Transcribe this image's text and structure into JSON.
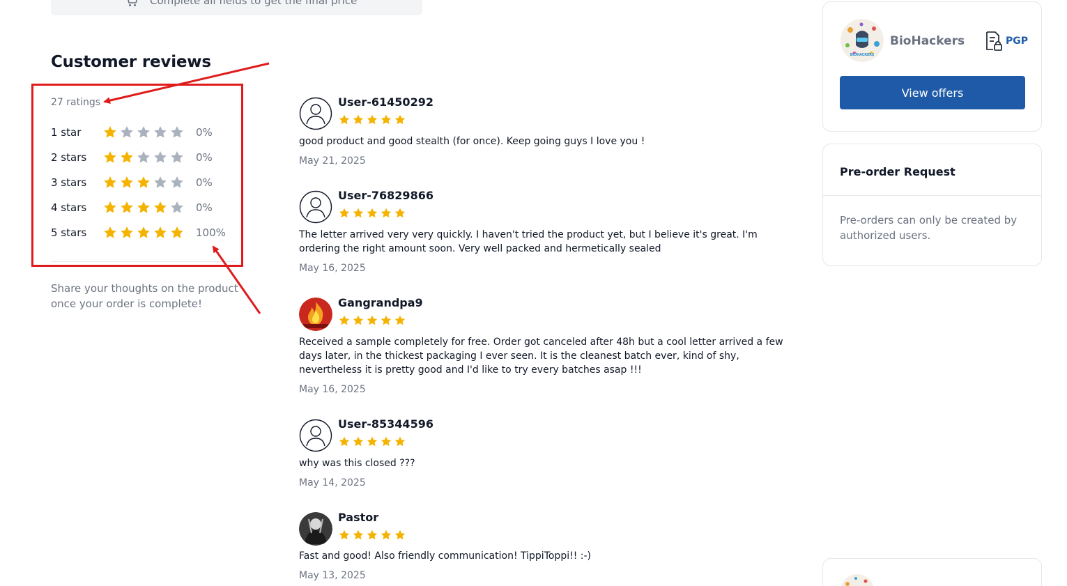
{
  "price_bar": {
    "text": "Complete all fields to get the final price"
  },
  "reviews": {
    "title": "Customer reviews",
    "ratings_count": "27 ratings",
    "breakdown": [
      {
        "label": "1 star",
        "filled": 1,
        "percent": "0%"
      },
      {
        "label": "2 stars",
        "filled": 2,
        "percent": "0%"
      },
      {
        "label": "3 stars",
        "filled": 3,
        "percent": "0%"
      },
      {
        "label": "4 stars",
        "filled": 4,
        "percent": "0%"
      },
      {
        "label": "5 stars",
        "filled": 5,
        "percent": "100%"
      }
    ],
    "share_note": "Share your thoughts on the product once your order is complete!",
    "items": [
      {
        "user": "User-61450292",
        "rating": 5,
        "text": "good product and good stealth (for once). Keep going guys I love you !",
        "date": "May 21, 2025",
        "avatar": "default-avatar"
      },
      {
        "user": "User-76829866",
        "rating": 5,
        "text": "The letter arrived very very quickly. I haven't tried the product yet, but I believe it's great. I'm ordering the right amount soon. Very well packed and hermetically sealed",
        "date": "May 16, 2025",
        "avatar": "default-avatar"
      },
      {
        "user": "Gangrandpa9",
        "rating": 5,
        "text": "Received a sample completely for free. Order got canceled after 48h but a cool letter arrived a few days later, in the thickest packaging I ever seen. It is the cleanest batch ever, kind of shy, nevertheless it is pretty good and I'd like to try every batches asap !!!",
        "date": "May 16, 2025",
        "avatar": "fire-avatar"
      },
      {
        "user": "User-85344596",
        "rating": 5,
        "text": "why was this closed ???",
        "date": "May 14, 2025",
        "avatar": "default-avatar"
      },
      {
        "user": "Pastor",
        "rating": 5,
        "text": "Fast and good! Also friendly communication! TippiToppi!! :-)",
        "date": "May 13, 2025",
        "avatar": "photo-avatar"
      }
    ]
  },
  "vendor": {
    "name": "BioHackers",
    "logo_text": "BIOHACKERS",
    "pgp_label": "PGP",
    "view_offers_label": "View offers"
  },
  "preorder": {
    "title": "Pre-order Request",
    "text": "Pre-orders can only be created by authorized users."
  },
  "colors": {
    "star_filled": "#f5b301",
    "star_empty": "#aab2bd",
    "primary": "#1e5aa8",
    "annotation": "#e01b1b"
  }
}
